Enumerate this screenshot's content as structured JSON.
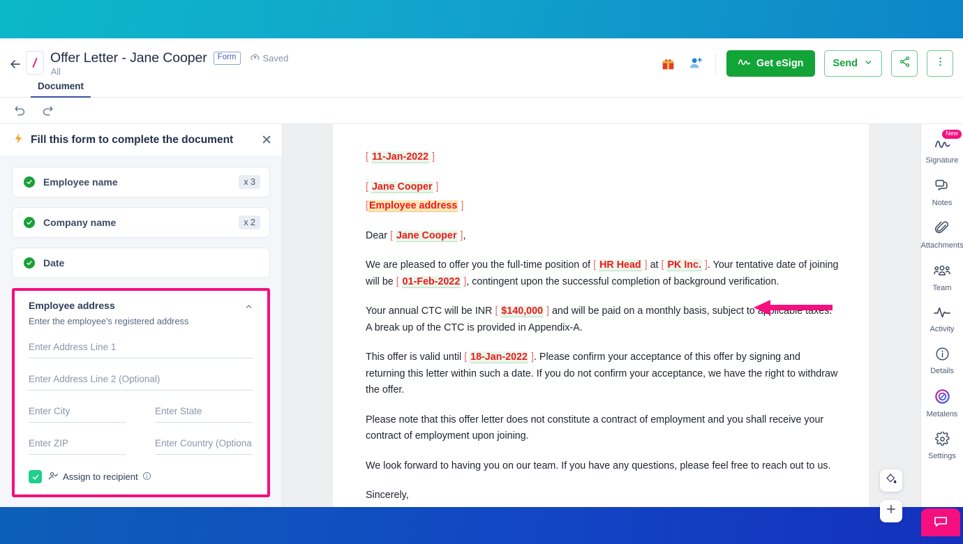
{
  "header": {
    "back_icon": "back-arrow-icon",
    "doc_icon": "document-thumbnail-icon",
    "title": "Offer Letter - Jane Cooper",
    "badge": "Form",
    "saved_label": "Saved",
    "subtitle": "All",
    "tabs": [
      {
        "label": "Document",
        "active": true
      }
    ],
    "actions": {
      "gift_icon": "gift-icon",
      "add_user_icon": "add-user-icon",
      "esign_label": "Get eSign",
      "send_label": "Send",
      "share_icon": "share-icon",
      "more_icon": "more-vertical-icon"
    }
  },
  "toolstrip": {
    "undo_icon": "undo-icon",
    "redo_icon": "redo-icon"
  },
  "left_panel": {
    "header_title": "Fill this form to complete the document",
    "bolt_icon": "lightning-bolt-icon",
    "close_icon": "close-icon",
    "fields": [
      {
        "label": "Employee name",
        "count": "x 3",
        "complete": true
      },
      {
        "label": "Company name",
        "count": "x 2",
        "complete": true
      },
      {
        "label": "Date",
        "count": "",
        "complete": true
      }
    ],
    "address_card": {
      "title": "Employee address",
      "collapse_icon": "chevron-up-icon",
      "description": "Enter the employee's registered address",
      "inputs": {
        "line1": {
          "placeholder": "Enter Address Line 1",
          "value": ""
        },
        "line2": {
          "placeholder": "Enter Address Line 2 (Optional)",
          "value": ""
        },
        "city": {
          "placeholder": "Enter City",
          "value": ""
        },
        "state": {
          "placeholder": "Enter State",
          "value": ""
        },
        "zip": {
          "placeholder": "Enter ZIP",
          "value": ""
        },
        "country": {
          "placeholder": "Enter Country (Optional)",
          "value": ""
        }
      },
      "assign": {
        "label": "Assign to recipient",
        "checked": true,
        "person_icon": "assign-person-icon",
        "info_icon": "info-icon"
      },
      "highlight_color": "#f50f7f"
    }
  },
  "document": {
    "date": "11-Jan-2022",
    "recipient_name": "Jane Cooper",
    "recipient_address": "Employee address",
    "salutation_prefix": "Dear",
    "salutation_name": "Jane Cooper",
    "salutation_suffix": ",",
    "p1_a": "We are pleased to offer you the full-time position of",
    "p1_role": "HR Head",
    "p1_b": "at",
    "p1_company": "PK Inc.",
    "p1_c": ". Your tentative date of joining will be",
    "p1_joindate": "01-Feb-2022",
    "p1_d": ", contingent upon the successful completion of background verification.",
    "p2_a": "Your annual CTC will be INR",
    "p2_ctc": "$140,000",
    "p2_b": "and will be paid on a monthly basis, subject to applicable taxes. A break up of the CTC is provided in Appendix-A.",
    "p3_a": "This offer is valid until",
    "p3_validdate": "18-Jan-2022",
    "p3_b": ". Please confirm your acceptance of this offer by signing and returning this letter within such a date. If you do not confirm your acceptance, we have the right to withdraw the offer.",
    "p4": "Please note that this offer letter does not constitute a contract of employment and you shall receive your contract of employment upon joining.",
    "p5": "We look forward to having you on our team. If you have any questions, please feel free to reach out to us.",
    "p6": "Sincerely,",
    "annotation_arrow": "annotation-arrow",
    "annotation_color": "#f50f7f"
  },
  "right_rail": {
    "items": [
      {
        "label": "Signature",
        "icon": "signature-icon",
        "badge": "New"
      },
      {
        "label": "Notes",
        "icon": "notes-icon",
        "badge": ""
      },
      {
        "label": "Attachments",
        "icon": "attachment-icon",
        "badge": ""
      },
      {
        "label": "Team",
        "icon": "team-icon",
        "badge": ""
      },
      {
        "label": "Activity",
        "icon": "activity-icon",
        "badge": ""
      },
      {
        "label": "Details",
        "icon": "info-circle-icon",
        "badge": ""
      },
      {
        "label": "Metalens",
        "icon": "metalens-icon",
        "badge": ""
      },
      {
        "label": "Settings",
        "icon": "gear-icon",
        "badge": ""
      }
    ]
  },
  "floating": {
    "fill_icon": "paint-bucket-icon",
    "add_icon": "plus-icon",
    "chat_icon": "chat-bubble-icon"
  },
  "colors": {
    "brand_green": "#13a438",
    "highlight_pink": "#f50f7f",
    "placeholder_red": "#f01818",
    "band_top": "#0bb8c8",
    "band_bottom": "#1430bd"
  }
}
